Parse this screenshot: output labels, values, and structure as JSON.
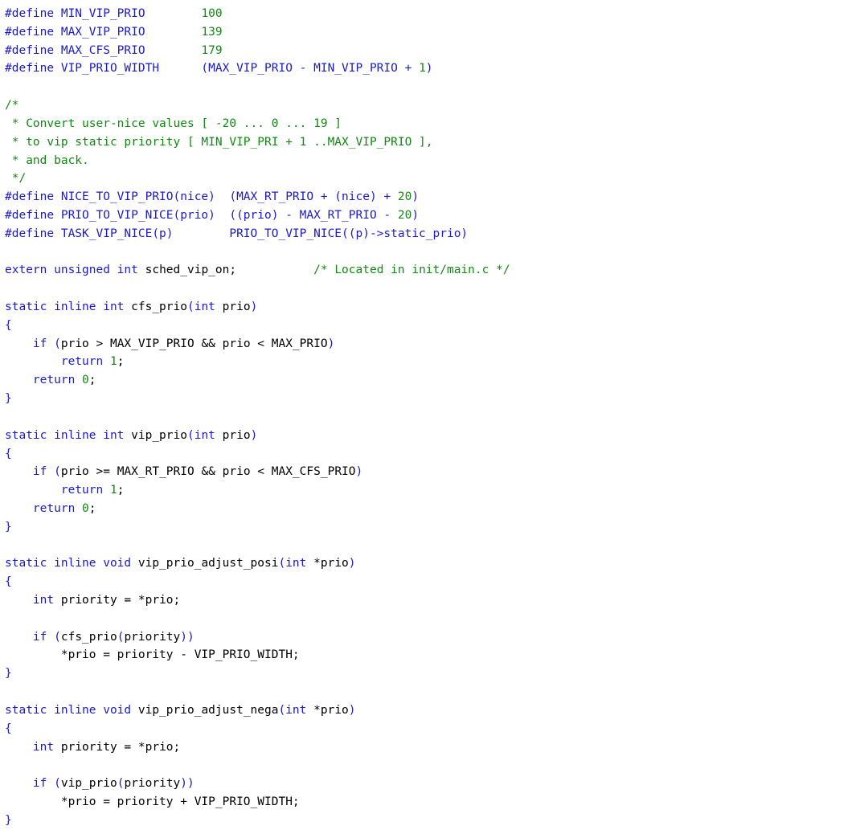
{
  "editor": {
    "colors": {
      "background": "#ffffff",
      "keyword": "#1a1acc",
      "number": "#118811",
      "comment": "#118811",
      "text": "#000000"
    },
    "lines": [
      [
        {
          "t": "pp",
          "v": "#define MIN_VIP_PRIO        "
        },
        {
          "t": "num",
          "v": "100"
        }
      ],
      [
        {
          "t": "pp",
          "v": "#define MAX_VIP_PRIO        "
        },
        {
          "t": "num",
          "v": "139"
        }
      ],
      [
        {
          "t": "pp",
          "v": "#define MAX_CFS_PRIO        "
        },
        {
          "t": "num",
          "v": "179"
        }
      ],
      [
        {
          "t": "pp",
          "v": "#define VIP_PRIO_WIDTH      (MAX_VIP_PRIO - MIN_VIP_PRIO + "
        },
        {
          "t": "num",
          "v": "1"
        },
        {
          "t": "pp",
          "v": ")"
        }
      ],
      [],
      [
        {
          "t": "com",
          "v": "/*"
        }
      ],
      [
        {
          "t": "com",
          "v": " * Convert user-nice values [ -20 ... 0 ... 19 ]"
        }
      ],
      [
        {
          "t": "com",
          "v": " * to vip static priority [ MIN_VIP_PRI + 1 ..MAX_VIP_PRIO ],"
        }
      ],
      [
        {
          "t": "com",
          "v": " * and back."
        }
      ],
      [
        {
          "t": "com",
          "v": " */"
        }
      ],
      [
        {
          "t": "pp",
          "v": "#define NICE_TO_VIP_PRIO(nice)  (MAX_RT_PRIO + (nice) + "
        },
        {
          "t": "num",
          "v": "20"
        },
        {
          "t": "pp",
          "v": ")"
        }
      ],
      [
        {
          "t": "pp",
          "v": "#define PRIO_TO_VIP_NICE(prio)  ((prio) - MAX_RT_PRIO - "
        },
        {
          "t": "num",
          "v": "20"
        },
        {
          "t": "pp",
          "v": ")"
        }
      ],
      [
        {
          "t": "pp",
          "v": "#define TASK_VIP_NICE(p)        PRIO_TO_VIP_NICE((p)->static_prio)"
        }
      ],
      [],
      [
        {
          "t": "kw",
          "v": "extern unsigned int"
        },
        {
          "t": "plain",
          "v": " sched_vip_on;           "
        },
        {
          "t": "com",
          "v": "/* Located in init/main.c */"
        }
      ],
      [],
      [
        {
          "t": "kw",
          "v": "static inline int"
        },
        {
          "t": "plain",
          "v": " cfs_prio"
        },
        {
          "t": "paren",
          "v": "("
        },
        {
          "t": "kw",
          "v": "int"
        },
        {
          "t": "plain",
          "v": " prio"
        },
        {
          "t": "paren",
          "v": ")"
        }
      ],
      [
        {
          "t": "paren",
          "v": "{"
        }
      ],
      [
        {
          "t": "plain",
          "v": "    "
        },
        {
          "t": "kw",
          "v": "if"
        },
        {
          "t": "plain",
          "v": " "
        },
        {
          "t": "paren",
          "v": "("
        },
        {
          "t": "plain",
          "v": "prio > MAX_VIP_PRIO && prio < MAX_PRIO"
        },
        {
          "t": "paren",
          "v": ")"
        }
      ],
      [
        {
          "t": "plain",
          "v": "        "
        },
        {
          "t": "kw",
          "v": "return"
        },
        {
          "t": "plain",
          "v": " "
        },
        {
          "t": "num",
          "v": "1"
        },
        {
          "t": "plain",
          "v": ";"
        }
      ],
      [
        {
          "t": "plain",
          "v": "    "
        },
        {
          "t": "kw",
          "v": "return"
        },
        {
          "t": "plain",
          "v": " "
        },
        {
          "t": "num",
          "v": "0"
        },
        {
          "t": "plain",
          "v": ";"
        }
      ],
      [
        {
          "t": "paren",
          "v": "}"
        }
      ],
      [],
      [
        {
          "t": "kw",
          "v": "static inline int"
        },
        {
          "t": "plain",
          "v": " vip_prio"
        },
        {
          "t": "paren",
          "v": "("
        },
        {
          "t": "kw",
          "v": "int"
        },
        {
          "t": "plain",
          "v": " prio"
        },
        {
          "t": "paren",
          "v": ")"
        }
      ],
      [
        {
          "t": "paren",
          "v": "{"
        }
      ],
      [
        {
          "t": "plain",
          "v": "    "
        },
        {
          "t": "kw",
          "v": "if"
        },
        {
          "t": "plain",
          "v": " "
        },
        {
          "t": "paren",
          "v": "("
        },
        {
          "t": "plain",
          "v": "prio >= MAX_RT_PRIO && prio < MAX_CFS_PRIO"
        },
        {
          "t": "paren",
          "v": ")"
        }
      ],
      [
        {
          "t": "plain",
          "v": "        "
        },
        {
          "t": "kw",
          "v": "return"
        },
        {
          "t": "plain",
          "v": " "
        },
        {
          "t": "num",
          "v": "1"
        },
        {
          "t": "plain",
          "v": ";"
        }
      ],
      [
        {
          "t": "plain",
          "v": "    "
        },
        {
          "t": "kw",
          "v": "return"
        },
        {
          "t": "plain",
          "v": " "
        },
        {
          "t": "num",
          "v": "0"
        },
        {
          "t": "plain",
          "v": ";"
        }
      ],
      [
        {
          "t": "paren",
          "v": "}"
        }
      ],
      [],
      [
        {
          "t": "kw",
          "v": "static inline void"
        },
        {
          "t": "plain",
          "v": " vip_prio_adjust_posi"
        },
        {
          "t": "paren",
          "v": "("
        },
        {
          "t": "kw",
          "v": "int"
        },
        {
          "t": "plain",
          "v": " *prio"
        },
        {
          "t": "paren",
          "v": ")"
        }
      ],
      [
        {
          "t": "paren",
          "v": "{"
        }
      ],
      [
        {
          "t": "plain",
          "v": "    "
        },
        {
          "t": "kw",
          "v": "int"
        },
        {
          "t": "plain",
          "v": " priority = *prio;"
        }
      ],
      [],
      [
        {
          "t": "plain",
          "v": "    "
        },
        {
          "t": "kw",
          "v": "if"
        },
        {
          "t": "plain",
          "v": " "
        },
        {
          "t": "paren",
          "v": "("
        },
        {
          "t": "plain",
          "v": "cfs_prio"
        },
        {
          "t": "paren",
          "v": "("
        },
        {
          "t": "plain",
          "v": "priority"
        },
        {
          "t": "paren",
          "v": "))"
        }
      ],
      [
        {
          "t": "plain",
          "v": "        *prio = priority - VIP_PRIO_WIDTH;"
        }
      ],
      [
        {
          "t": "paren",
          "v": "}"
        }
      ],
      [],
      [
        {
          "t": "kw",
          "v": "static inline void"
        },
        {
          "t": "plain",
          "v": " vip_prio_adjust_nega"
        },
        {
          "t": "paren",
          "v": "("
        },
        {
          "t": "kw",
          "v": "int"
        },
        {
          "t": "plain",
          "v": " *prio"
        },
        {
          "t": "paren",
          "v": ")"
        }
      ],
      [
        {
          "t": "paren",
          "v": "{"
        }
      ],
      [
        {
          "t": "plain",
          "v": "    "
        },
        {
          "t": "kw",
          "v": "int"
        },
        {
          "t": "plain",
          "v": " priority = *prio;"
        }
      ],
      [],
      [
        {
          "t": "plain",
          "v": "    "
        },
        {
          "t": "kw",
          "v": "if"
        },
        {
          "t": "plain",
          "v": " "
        },
        {
          "t": "paren",
          "v": "("
        },
        {
          "t": "plain",
          "v": "vip_prio"
        },
        {
          "t": "paren",
          "v": "("
        },
        {
          "t": "plain",
          "v": "priority"
        },
        {
          "t": "paren",
          "v": "))"
        }
      ],
      [
        {
          "t": "plain",
          "v": "        *prio = priority + VIP_PRIO_WIDTH;"
        }
      ],
      [
        {
          "t": "paren",
          "v": "}"
        }
      ]
    ]
  }
}
